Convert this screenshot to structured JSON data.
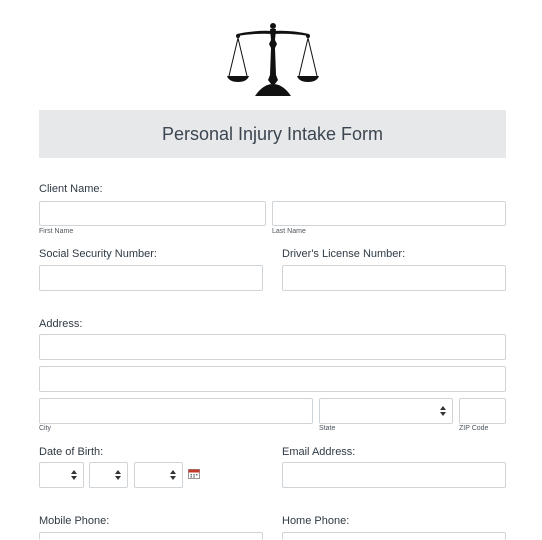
{
  "form": {
    "title": "Personal Injury Intake Form",
    "logo_icon": "scales-of-justice-icon",
    "client_name_label": "Client Name:",
    "first_name_sublabel": "First Name",
    "last_name_sublabel": "Last Name",
    "ssn_label": "Social Security Number:",
    "license_label": "Driver's License Number:",
    "address_label": "Address:",
    "city_sublabel": "City",
    "state_sublabel": "State",
    "zip_sublabel": "ZIP Code",
    "dob_label": "Date of Birth:",
    "calendar_icon": "calendar-icon",
    "email_label": "Email Address:",
    "mobile_label": "Mobile Phone:",
    "home_label": "Home Phone:"
  }
}
